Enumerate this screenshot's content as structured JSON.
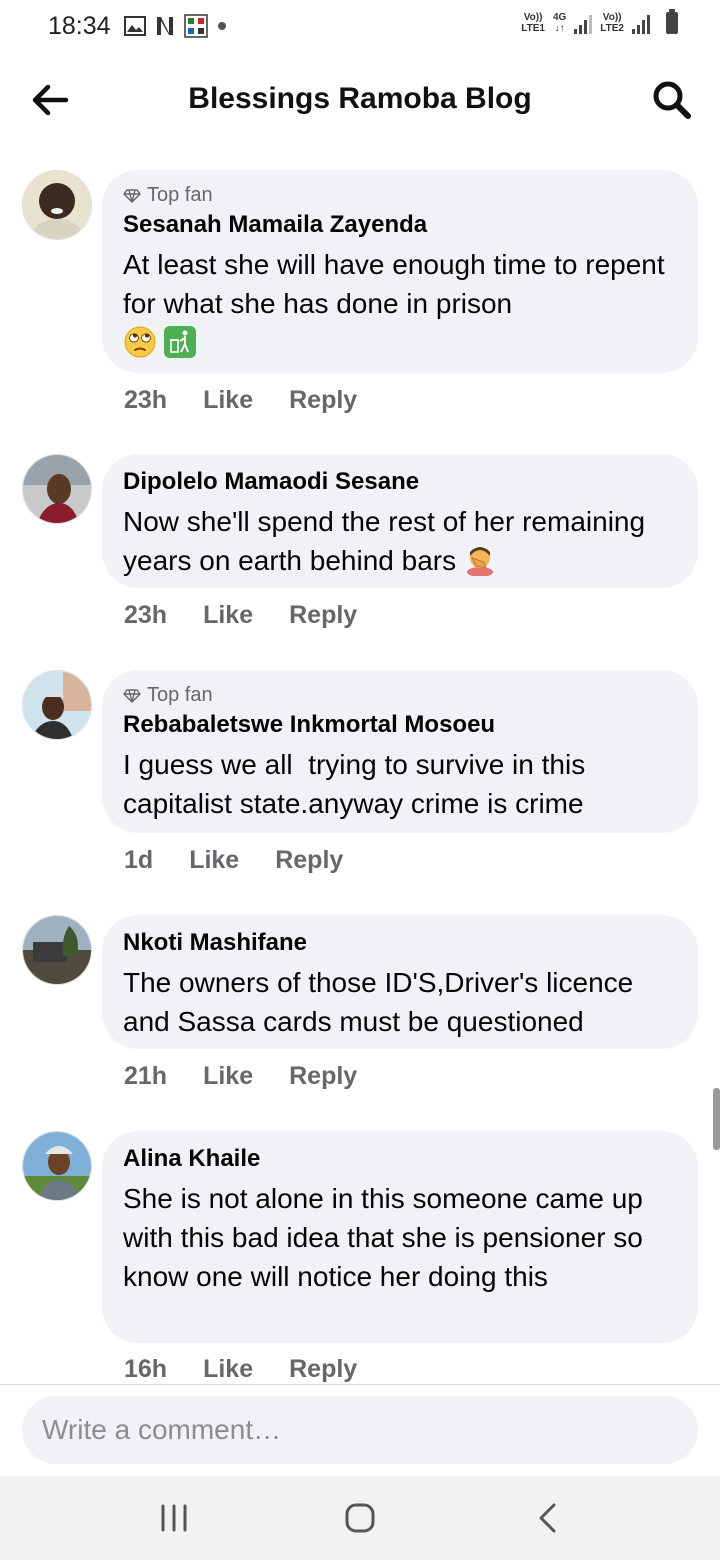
{
  "status_bar": {
    "time": "18:34",
    "left_icons": [
      "gallery-icon",
      "netflix-icon",
      "app-grid-icon",
      "dot-icon"
    ],
    "sim1": {
      "volte": "Vo))",
      "type": "LTE1"
    },
    "data": {
      "net": "4G",
      "arrows": "↓↑"
    },
    "sim2": {
      "volte": "Vo))",
      "type": "LTE2"
    }
  },
  "header": {
    "title": "Blessings Ramoba Blog",
    "back_icon": "arrow-left-icon",
    "search_icon": "search-icon"
  },
  "comments": [
    {
      "badge": "Top fan",
      "author": "Sesanah Mamaila Zayenda",
      "text": "At least she will have enough time to repent for what she has done in prison",
      "emojis": [
        "eye-roll-emoji",
        "trash-can-emoji"
      ],
      "time": "23h",
      "like": "Like",
      "reply": "Reply"
    },
    {
      "badge": "",
      "author": "Dipolelo Mamaodi Sesane",
      "text": "Now she'll spend the rest of her remaining years on earth behind bars",
      "emojis": [
        "facepalm-emoji"
      ],
      "time": "23h",
      "like": "Like",
      "reply": "Reply"
    },
    {
      "badge": "Top fan",
      "author": "Rebabaletswe Inkmortal Mosoeu",
      "text": "I guess we all  trying to survive in this capitalist state.anyway crime is crime",
      "emojis": [],
      "time": "1d",
      "like": "Like",
      "reply": "Reply"
    },
    {
      "badge": "",
      "author": "Nkoti Mashifane",
      "text": "The owners of those ID'S,Driver's licence and Sassa cards must be questioned",
      "emojis": [],
      "time": "21h",
      "like": "Like",
      "reply": "Reply"
    },
    {
      "badge": "",
      "author": "Alina Khaile",
      "text": "She is not alone in this someone came up with this bad idea that she is pensioner so know one will notice her doing this",
      "emojis": [],
      "time": "16h",
      "like": "Like",
      "reply": "Reply"
    }
  ],
  "composer": {
    "placeholder": "Write a comment…"
  },
  "navbar": {
    "icons": [
      "recent-apps-icon",
      "home-icon",
      "back-icon"
    ]
  }
}
